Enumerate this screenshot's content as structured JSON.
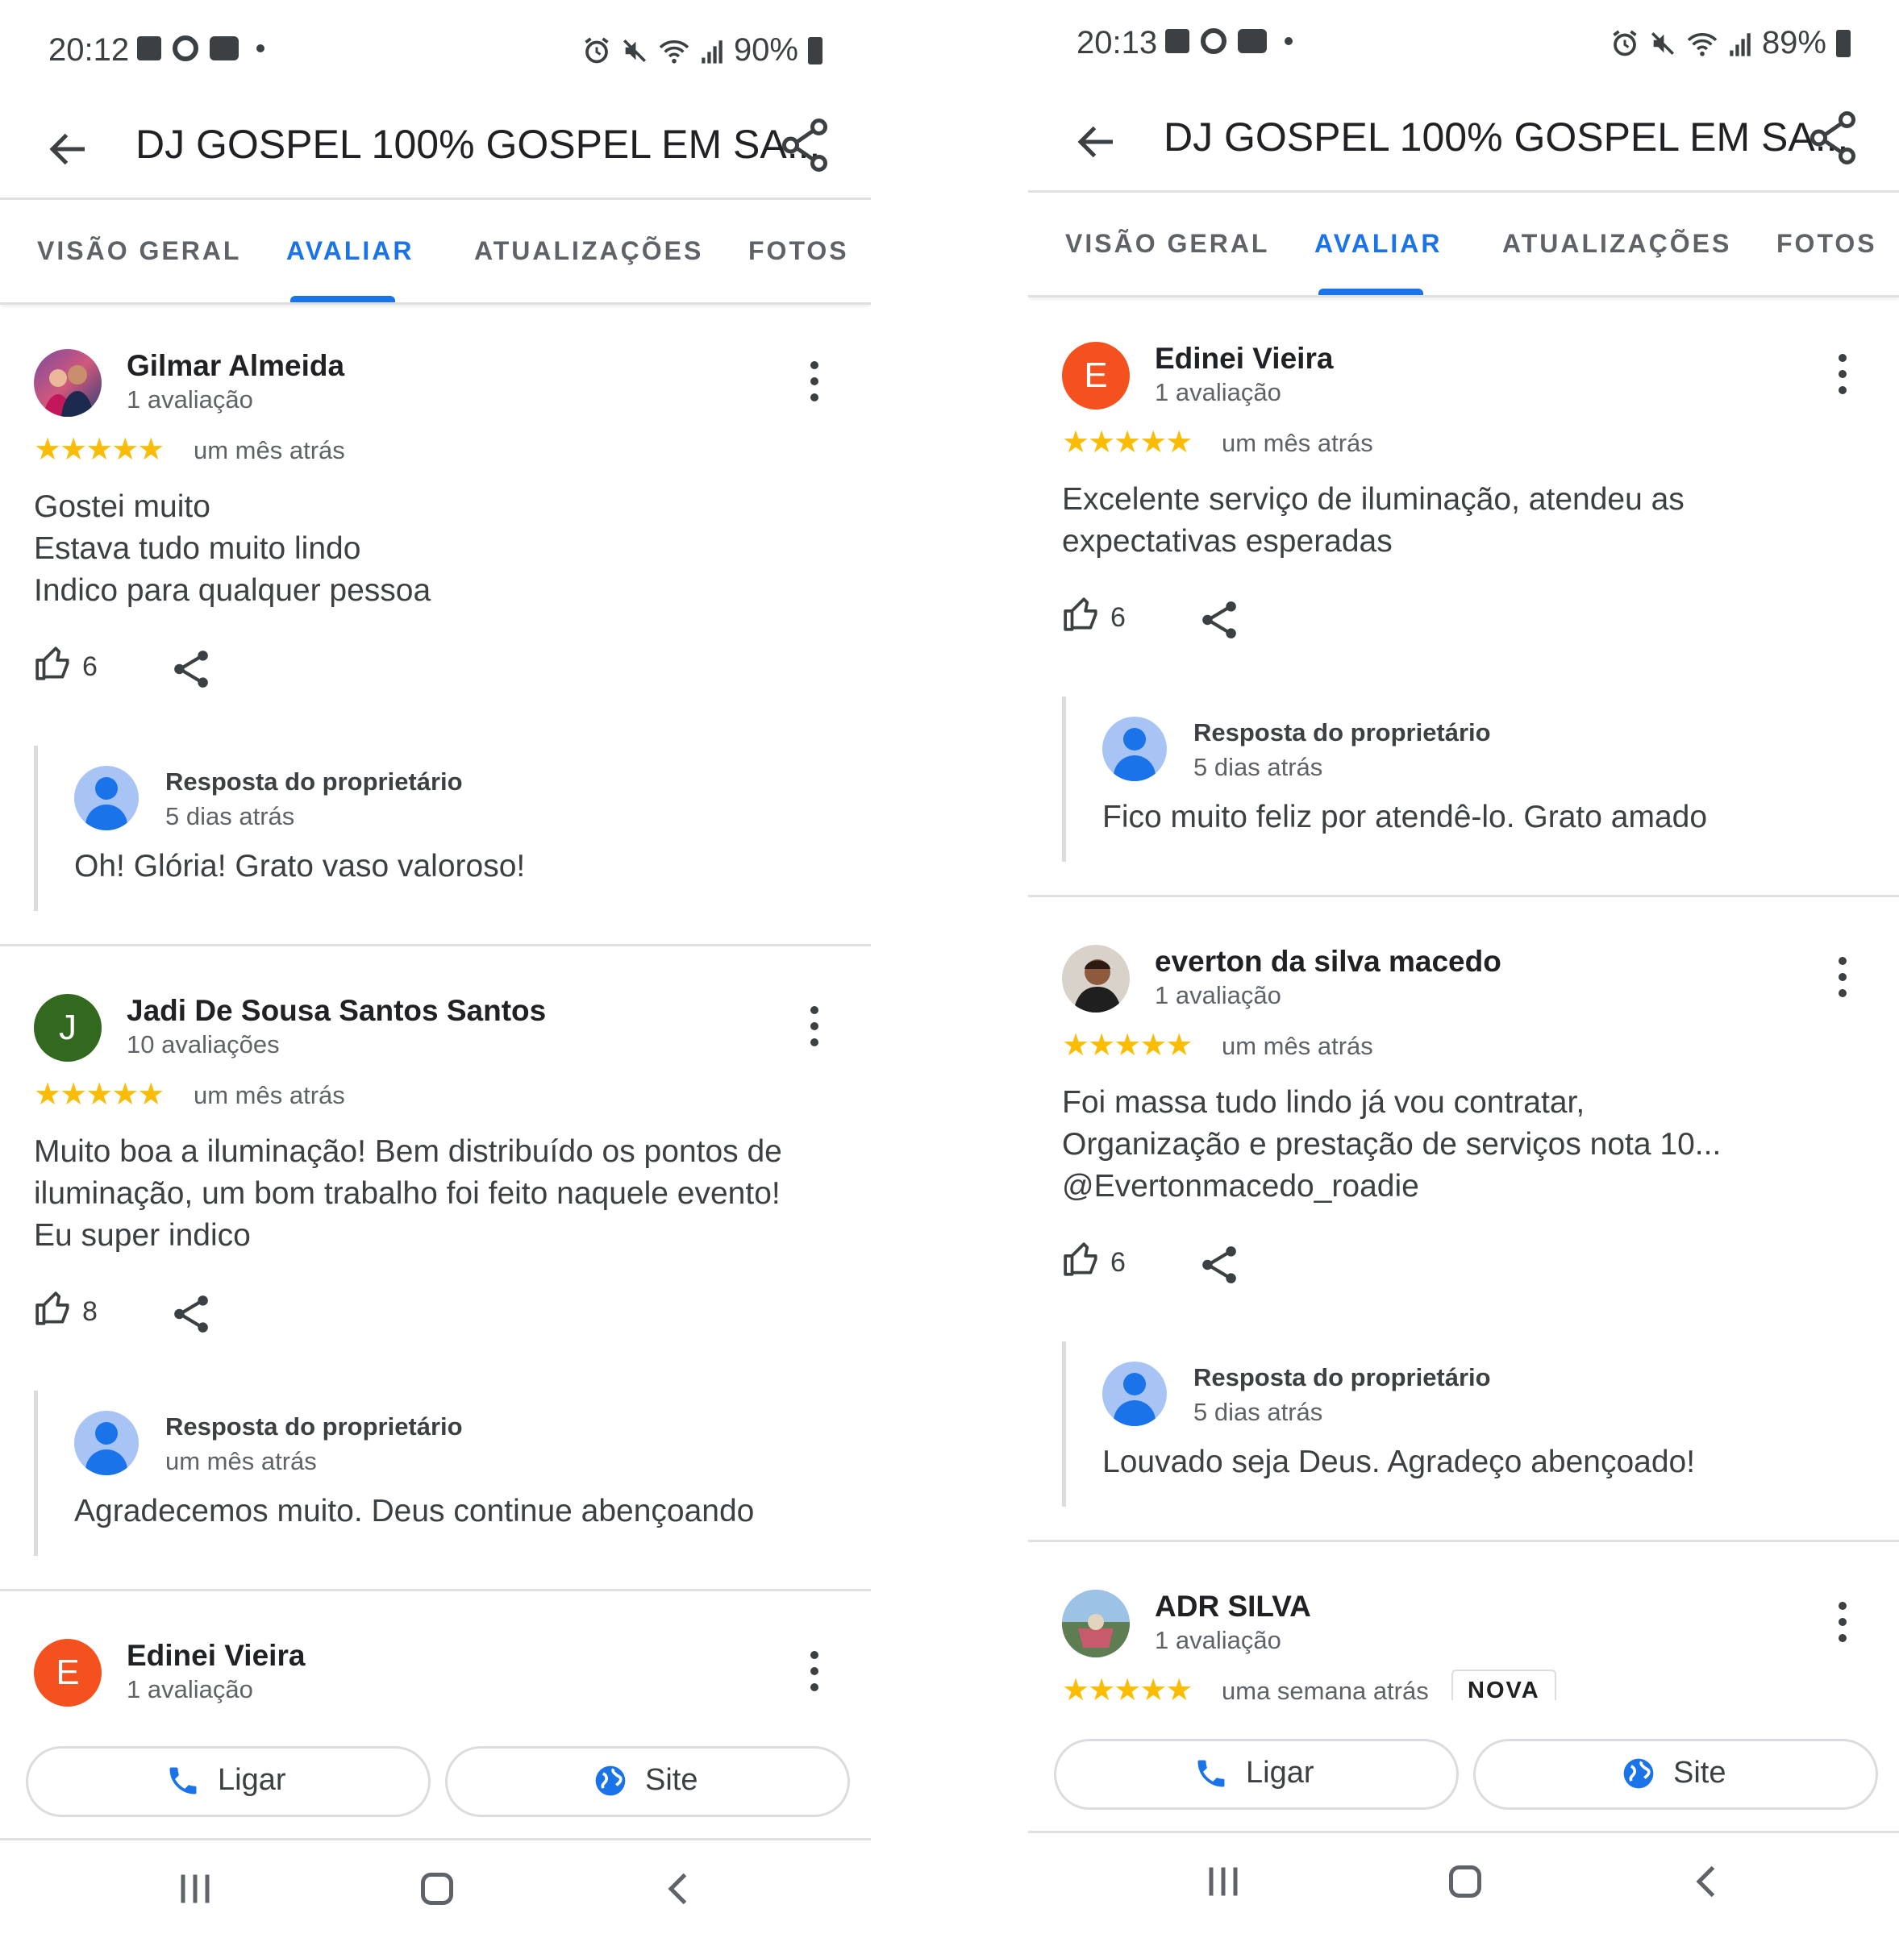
{
  "colors": {
    "accent": "#1a73e8",
    "star": "#fbbc04",
    "avatar_orange": "#f4511e",
    "avatar_green": "#33691e"
  },
  "left": {
    "status": {
      "time": "20:12",
      "battery": "90%"
    },
    "app_title": "DJ GOSPEL 100% GOSPEL EM SA...",
    "tabs": [
      "VISÃO GERAL",
      "AVALIAR",
      "ATUALIZAÇÕES",
      "FOTOS"
    ],
    "active_tab": "AVALIAR",
    "reviews": [
      {
        "name": "Gilmar Almeida",
        "count": "1 avaliação",
        "avatar": "photo",
        "stars": "★★★★★",
        "rating": 5,
        "time": "um mês atrás",
        "text": "Gostei muito\nEstava tudo muito lindo\nIndico para qualquer pessoa",
        "likes": "6",
        "owner": {
          "label": "Resposta do proprietário",
          "time": "5 dias atrás",
          "text": "Oh! Glória! Grato vaso valoroso!"
        }
      },
      {
        "name": "Jadi De Sousa Santos Santos",
        "count": "10 avaliações",
        "initial": "J",
        "stars": "★★★★★",
        "rating": 5,
        "time": "um mês atrás",
        "text": "Muito boa a iluminação! Bem distribuído os pontos de\niluminação, um bom trabalho foi feito naquele evento!\nEu super indico",
        "likes": "8",
        "owner": {
          "label": "Resposta do proprietário",
          "time": "um mês atrás",
          "text": "Agradecemos muito. Deus continue abençoando"
        }
      },
      {
        "name": "Edinei Vieira",
        "count": "1 avaliação",
        "initial": "E"
      }
    ],
    "actions": {
      "call": "Ligar",
      "site": "Site"
    }
  },
  "right": {
    "status": {
      "time": "20:13",
      "battery": "89%"
    },
    "app_title": "DJ GOSPEL 100% GOSPEL EM SA...",
    "tabs": [
      "VISÃO GERAL",
      "AVALIAR",
      "ATUALIZAÇÕES",
      "FOTOS"
    ],
    "active_tab": "AVALIAR",
    "reviews": [
      {
        "name": "Edinei Vieira",
        "count": "1 avaliação",
        "initial": "E",
        "stars": "★★★★★",
        "rating": 5,
        "time": "um mês atrás",
        "text": "Excelente serviço de iluminação, atendeu as\nexpectativas esperadas",
        "likes": "6",
        "owner": {
          "label": "Resposta do proprietário",
          "time": "5 dias atrás",
          "text": "Fico muito feliz por atendê-lo. Grato amado"
        }
      },
      {
        "name": "everton da silva macedo",
        "count": "1 avaliação",
        "avatar": "photo",
        "stars": "★★★★★",
        "rating": 5,
        "time": "um mês atrás",
        "text": "Foi massa tudo lindo já vou contratar,\nOrganização e prestação de serviços nota 10...\n@Evertonmacedo_roadie",
        "likes": "6",
        "owner": {
          "label": "Resposta do proprietário",
          "time": "5 dias atrás",
          "text": "Louvado seja Deus. Agradeço abençoado!"
        }
      },
      {
        "name": "ADR SILVA",
        "count": "1 avaliação",
        "avatar": "photo",
        "stars": "★★★★★",
        "rating": 5,
        "time": "uma semana atrás",
        "badge": "NOVA"
      }
    ],
    "actions": {
      "call": "Ligar",
      "site": "Site"
    }
  }
}
